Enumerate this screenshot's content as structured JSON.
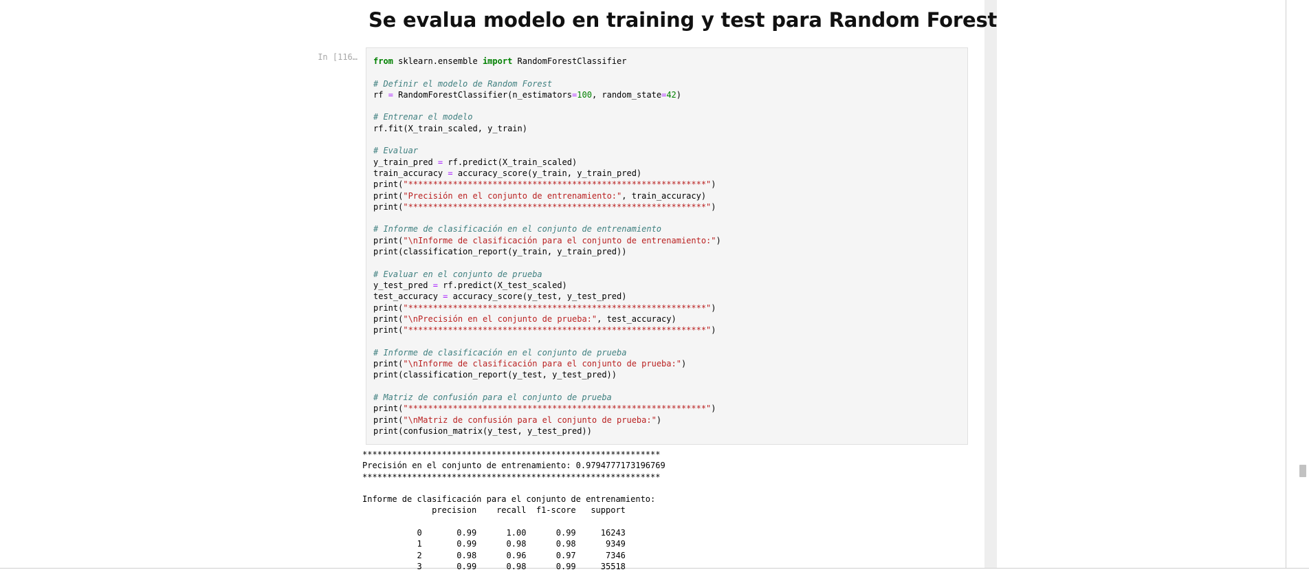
{
  "heading": "Se evalua modelo en training y test para Random Forest",
  "cell": {
    "prompt": "In [116…",
    "code_lines": [
      [
        {
          "t": "from",
          "c": "kw"
        },
        {
          "t": " sklearn.ensemble "
        },
        {
          "t": "import",
          "c": "kw"
        },
        {
          "t": " RandomForestClassifier"
        }
      ],
      [],
      [
        {
          "t": "# Definir el modelo de Random Forest",
          "c": "cm"
        }
      ],
      [
        {
          "t": "rf "
        },
        {
          "t": "=",
          "c": "op"
        },
        {
          "t": " RandomForestClassifier(n_estimators"
        },
        {
          "t": "=",
          "c": "op"
        },
        {
          "t": "100",
          "c": "nu"
        },
        {
          "t": ", random_state"
        },
        {
          "t": "=",
          "c": "op"
        },
        {
          "t": "42",
          "c": "nu"
        },
        {
          "t": ")"
        }
      ],
      [],
      [
        {
          "t": "# Entrenar el modelo",
          "c": "cm"
        }
      ],
      [
        {
          "t": "rf.fit(X_train_scaled, y_train)"
        }
      ],
      [],
      [
        {
          "t": "# Evaluar",
          "c": "cm"
        }
      ],
      [
        {
          "t": "y_train_pred "
        },
        {
          "t": "=",
          "c": "op"
        },
        {
          "t": " rf.predict(X_train_scaled)"
        }
      ],
      [
        {
          "t": "train_accuracy "
        },
        {
          "t": "=",
          "c": "op"
        },
        {
          "t": " accuracy_score(y_train, y_train_pred)"
        }
      ],
      [
        {
          "t": "print("
        },
        {
          "t": "\"************************************************************\"",
          "c": "st"
        },
        {
          "t": ")"
        }
      ],
      [
        {
          "t": "print("
        },
        {
          "t": "\"Precisión en el conjunto de entrenamiento:\"",
          "c": "st"
        },
        {
          "t": ", train_accuracy)"
        }
      ],
      [
        {
          "t": "print("
        },
        {
          "t": "\"************************************************************\"",
          "c": "st"
        },
        {
          "t": ")"
        }
      ],
      [],
      [
        {
          "t": "# Informe de clasificación en el conjunto de entrenamiento",
          "c": "cm"
        }
      ],
      [
        {
          "t": "print("
        },
        {
          "t": "\"\\nInforme de clasificación para el conjunto de entrenamiento:\"",
          "c": "st"
        },
        {
          "t": ")"
        }
      ],
      [
        {
          "t": "print(classification_report(y_train, y_train_pred))"
        }
      ],
      [],
      [
        {
          "t": "# Evaluar en el conjunto de prueba",
          "c": "cm"
        }
      ],
      [
        {
          "t": "y_test_pred "
        },
        {
          "t": "=",
          "c": "op"
        },
        {
          "t": " rf.predict(X_test_scaled)"
        }
      ],
      [
        {
          "t": "test_accuracy "
        },
        {
          "t": "=",
          "c": "op"
        },
        {
          "t": " accuracy_score(y_test, y_test_pred)"
        }
      ],
      [
        {
          "t": "print("
        },
        {
          "t": "\"************************************************************\"",
          "c": "st"
        },
        {
          "t": ")"
        }
      ],
      [
        {
          "t": "print("
        },
        {
          "t": "\"\\nPrecisión en el conjunto de prueba:\"",
          "c": "st"
        },
        {
          "t": ", test_accuracy)"
        }
      ],
      [
        {
          "t": "print("
        },
        {
          "t": "\"************************************************************\"",
          "c": "st"
        },
        {
          "t": ")"
        }
      ],
      [],
      [
        {
          "t": "# Informe de clasificación en el conjunto de prueba",
          "c": "cm"
        }
      ],
      [
        {
          "t": "print("
        },
        {
          "t": "\"\\nInforme de clasificación para el conjunto de prueba:\"",
          "c": "st"
        },
        {
          "t": ")"
        }
      ],
      [
        {
          "t": "print(classification_report(y_test, y_test_pred))"
        }
      ],
      [],
      [
        {
          "t": "# Matriz de confusión para el conjunto de prueba",
          "c": "cm"
        }
      ],
      [
        {
          "t": "print("
        },
        {
          "t": "\"************************************************************\"",
          "c": "st"
        },
        {
          "t": ")"
        }
      ],
      [
        {
          "t": "print("
        },
        {
          "t": "\"\\nMatriz de confusión para el conjunto de prueba:\"",
          "c": "st"
        },
        {
          "t": ")"
        }
      ],
      [
        {
          "t": "print(confusion_matrix(y_test, y_test_pred))"
        }
      ]
    ]
  },
  "output_lines": [
    "************************************************************",
    "Precisión en el conjunto de entrenamiento: 0.9794777173196769",
    "************************************************************",
    "",
    "Informe de clasificación para el conjunto de entrenamiento:",
    "              precision    recall  f1-score   support",
    "",
    "           0       0.99      1.00      0.99     16243",
    "           1       0.99      0.98      0.98      9349",
    "           2       0.98      0.96      0.97      7346",
    "           3       0.99      0.98      0.99     35518"
  ]
}
